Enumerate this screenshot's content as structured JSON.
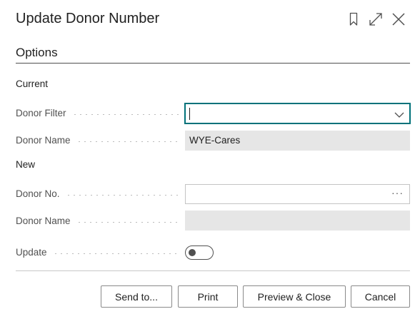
{
  "dialog": {
    "title": "Update Donor Number",
    "header_icons": [
      "bookmark-icon",
      "expand-icon",
      "close-icon"
    ]
  },
  "options": {
    "title": "Options",
    "current": {
      "label": "Current",
      "donor_filter": {
        "label": "Donor Filter",
        "value": ""
      },
      "donor_name": {
        "label": "Donor Name",
        "value": "WYE-Cares"
      }
    },
    "new": {
      "label": "New",
      "donor_no": {
        "label": "Donor No.",
        "value": "",
        "lookup_glyph": "···"
      },
      "donor_name": {
        "label": "Donor Name",
        "value": ""
      }
    },
    "update": {
      "label": "Update",
      "value": false
    }
  },
  "footer": {
    "send_to": "Send to...",
    "print": "Print",
    "preview_close": "Preview & Close",
    "cancel": "Cancel"
  },
  "colors": {
    "accent": "#00727a",
    "readonly_bg": "#e6e6e6",
    "text": "#212121",
    "label": "#505050"
  }
}
